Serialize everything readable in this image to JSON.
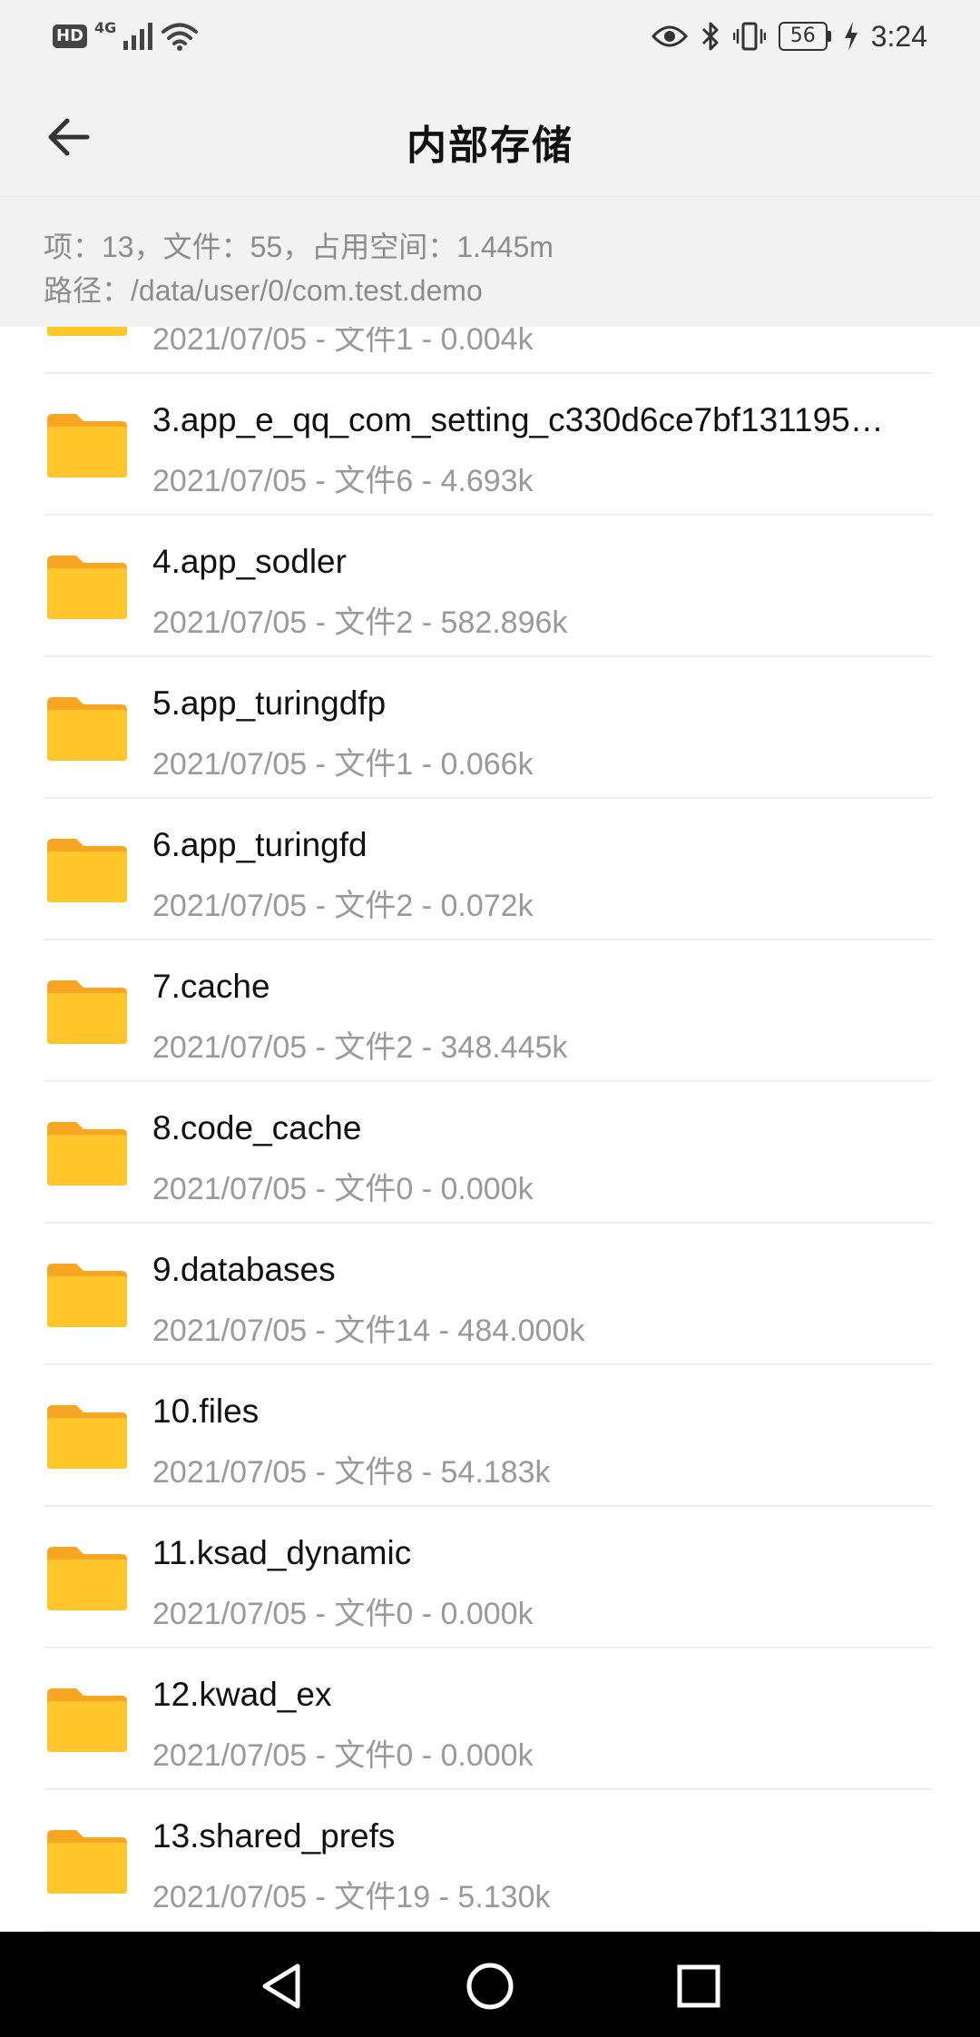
{
  "status_bar": {
    "hd": "HD",
    "network": "4G",
    "battery": "56",
    "time": "3:24"
  },
  "app_bar": {
    "title": "内部存储",
    "back_icon": "arrow-left-icon"
  },
  "info": {
    "summary": "项：13，文件：55，占用空间：1.445m",
    "path": "路径：/data/user/0/com.test.demo"
  },
  "folders": [
    {
      "name": "",
      "meta": "2021/07/05 - 文件1 - 0.004k"
    },
    {
      "name": "3.app_e_qq_com_setting_c330d6ce7bf131195…",
      "meta": "2021/07/05 - 文件6 - 4.693k"
    },
    {
      "name": "4.app_sodler",
      "meta": "2021/07/05 - 文件2 - 582.896k"
    },
    {
      "name": "5.app_turingdfp",
      "meta": "2021/07/05 - 文件1 - 0.066k"
    },
    {
      "name": "6.app_turingfd",
      "meta": "2021/07/05 - 文件2 - 0.072k"
    },
    {
      "name": "7.cache",
      "meta": "2021/07/05 - 文件2 - 348.445k"
    },
    {
      "name": "8.code_cache",
      "meta": "2021/07/05 - 文件0 - 0.000k"
    },
    {
      "name": "9.databases",
      "meta": "2021/07/05 - 文件14 - 484.000k"
    },
    {
      "name": "10.files",
      "meta": "2021/07/05 - 文件8 - 54.183k"
    },
    {
      "name": "11.ksad_dynamic",
      "meta": "2021/07/05 - 文件0 - 0.000k"
    },
    {
      "name": "12.kwad_ex",
      "meta": "2021/07/05 - 文件0 - 0.000k"
    },
    {
      "name": "13.shared_prefs",
      "meta": "2021/07/05 - 文件19 - 5.130k"
    }
  ],
  "colors": {
    "folder_front": "#FFC72C",
    "folder_back": "#F6A623",
    "header_bg": "#f2f2f2",
    "meta_text": "#999999"
  },
  "nav_bar": {
    "back": "triangle-back-icon",
    "home": "circle-home-icon",
    "recents": "square-recents-icon"
  }
}
